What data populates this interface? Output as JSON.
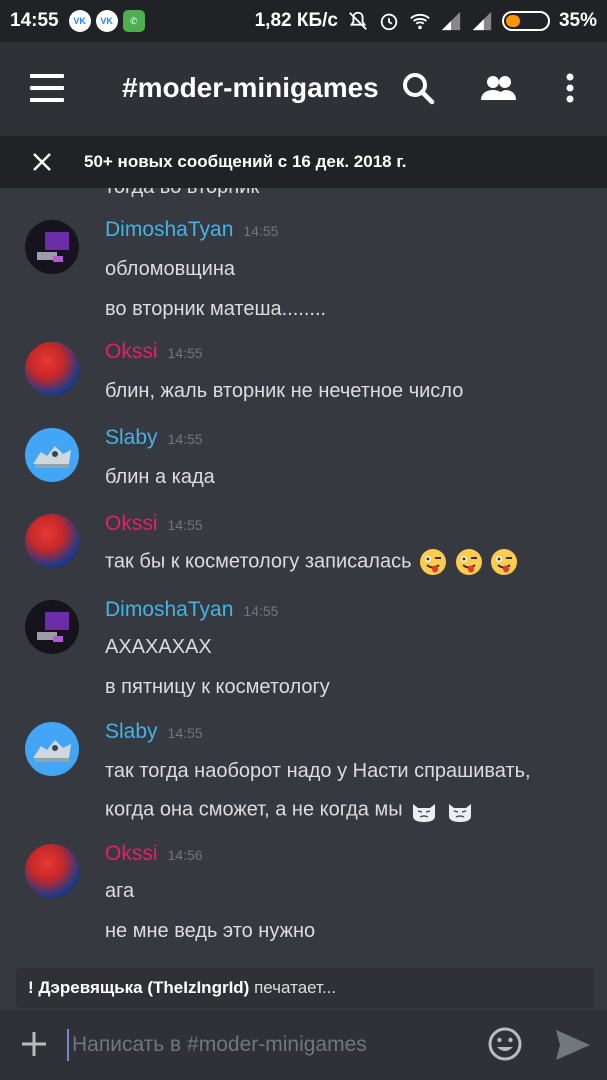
{
  "status_bar": {
    "time": "14:55",
    "apps": [
      "VK",
      "VK"
    ],
    "network_speed": "1,82 КБ/с",
    "battery_percent": "35%",
    "battery_level": 0.35,
    "icons": [
      "vk-icon",
      "vk-icon",
      "whatsapp-icon",
      "mute-icon",
      "alarm-icon",
      "wifi-icon",
      "signal-icon",
      "signal-icon",
      "battery-icon"
    ]
  },
  "header": {
    "channel": "#moder-minigames",
    "icons": [
      "menu-icon",
      "search-icon",
      "members-icon",
      "more-icon"
    ]
  },
  "banner": {
    "text": "50+ новых сообщений с 16 дек. 2018 г."
  },
  "cut_message": "тогда во вторник",
  "messages": [
    {
      "author": "DimoshaTyan",
      "time": "14:55",
      "color": "#43b4e7",
      "avatar": "dimosha",
      "lines": [
        "обломовщина",
        "во вторник матеша........"
      ]
    },
    {
      "author": "Okssi",
      "time": "14:55",
      "color": "#e91e63",
      "avatar": "okssi",
      "lines": [
        "блин, жаль вторник не нечетное число"
      ]
    },
    {
      "author": "Slaby",
      "time": "14:55",
      "color": "#43b4e7",
      "avatar": "slaby",
      "lines": [
        "блин а када"
      ]
    },
    {
      "author": "Okssi",
      "time": "14:55",
      "color": "#e91e63",
      "avatar": "okssi",
      "lines": [
        "так бы к косметологу записалась"
      ]
    },
    {
      "author": "DimoshaTyan",
      "time": "14:55",
      "color": "#43b4e7",
      "avatar": "dimosha",
      "lines": [
        "АХАХАХАХ",
        "в пятницу к косметологу"
      ]
    },
    {
      "author": "Slaby",
      "time": "14:55",
      "color": "#43b4e7",
      "avatar": "slaby",
      "lines": [
        "так тогда наоборот надо у Насти спрашивать,",
        "когда она сможет, а не когда мы"
      ]
    },
    {
      "author": "Okssi",
      "time": "14:56",
      "color": "#e91e63",
      "avatar": "okssi",
      "lines": [
        "ага",
        "не мне ведь это нужно"
      ]
    }
  ],
  "typing": {
    "name": "! Дэревящька (TheIzIngrId)",
    "text": "печатает..."
  },
  "composer": {
    "placeholder": "Написать в #moder-minigames"
  }
}
